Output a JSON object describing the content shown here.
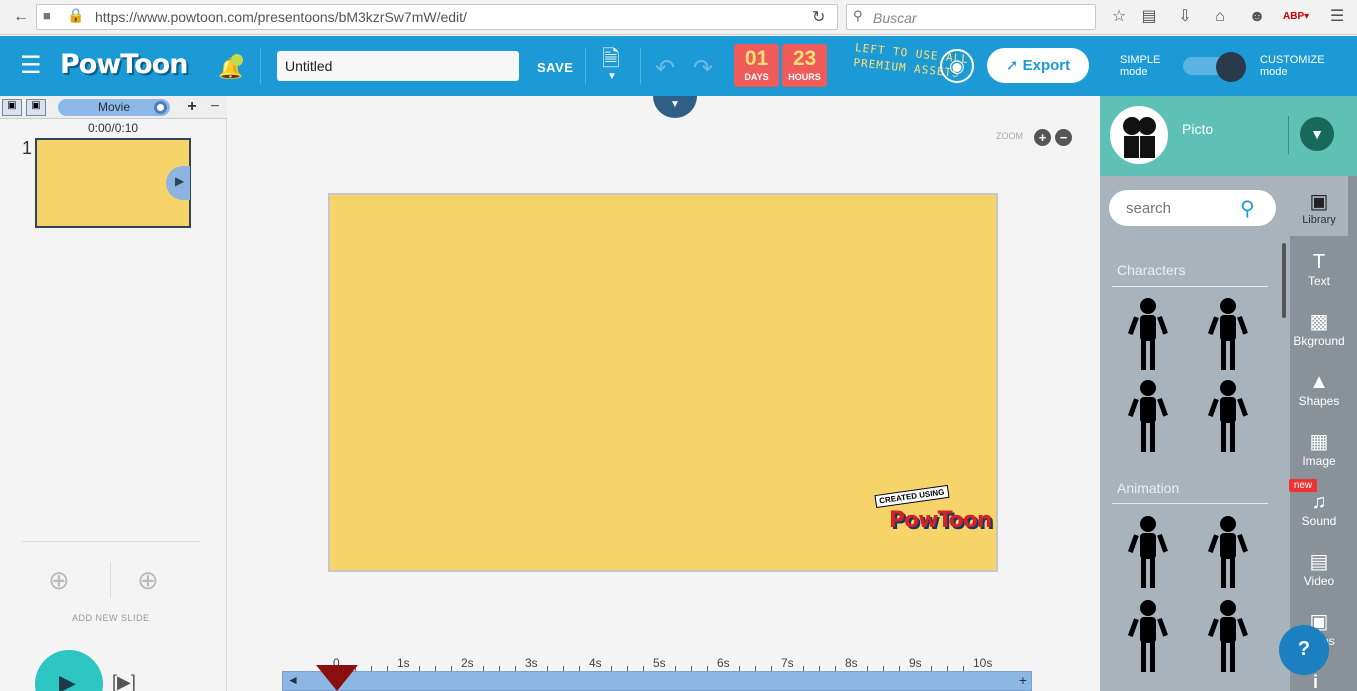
{
  "browser": {
    "url": "https://www.powtoon.com/presentoons/bM3kzrSw7mW/edit/",
    "search_placeholder": "Buscar"
  },
  "app": {
    "logo": "PowToon",
    "title_value": "Untitled",
    "save_label": "SAVE",
    "timer": {
      "days": "01",
      "days_label": "DAYS",
      "hours": "23",
      "hours_label": "HOURS"
    },
    "promo_line1": "LEFT TO USE ALL",
    "promo_line2": "PREMIUM ASSETS",
    "export_label": "Export"
  },
  "mode": {
    "simple_line1": "SIMPLE",
    "simple_line2": "mode",
    "customize_line1": "CUSTOMIZE",
    "customize_line2": "mode"
  },
  "library": {
    "character_name": "Picto",
    "search_placeholder": "search",
    "categories": [
      "Characters",
      "Animation"
    ]
  },
  "tools": [
    "Library",
    "Text",
    "Bkground",
    "Shapes",
    "Image",
    "Sound",
    "Video",
    "Props"
  ],
  "sound_badge": "new",
  "slides": {
    "movie_label": "Movie",
    "timecode": "0:00/0:10",
    "slide_number": "1",
    "add_new_slide": "ADD NEW SLIDE"
  },
  "canvas": {
    "zoom_label": "ZOOM",
    "watermark_top": "CREATED USING",
    "watermark_brand": "PowToon"
  },
  "timeline": {
    "ticks": [
      "0",
      "1s",
      "2s",
      "3s",
      "4s",
      "5s",
      "6s",
      "7s",
      "8s",
      "9s",
      "10s"
    ]
  },
  "colors": {
    "header": "#1c9ad6",
    "slide_bg": "#f7d46a",
    "timer": "#ef5a5a",
    "picto_bar": "#5fc0b5"
  }
}
